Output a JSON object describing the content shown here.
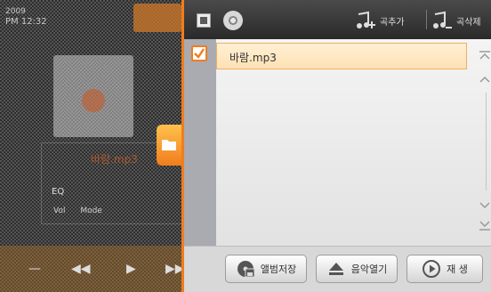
{
  "background_player": {
    "date": "2009",
    "time": "PM 12:32",
    "song": "바람.mp3",
    "eq_label": "EQ",
    "row": "Vol Mode",
    "controls": [
      "—",
      "◀◀",
      "▶",
      "▶▶"
    ]
  },
  "panel": {
    "header": {
      "add_song_label": "곡추가",
      "delete_song_label": "곡삭제"
    },
    "list": [
      {
        "name": "바람.mp3",
        "checked": true,
        "selected": true
      }
    ],
    "footer": {
      "save_album_label": "앨범저장",
      "open_music_label": "음악열기",
      "play_label": "재 생"
    }
  },
  "colors": {
    "accent": "#f07d1d",
    "header_bg": "#333333",
    "list_bg": "#eeeeee"
  }
}
